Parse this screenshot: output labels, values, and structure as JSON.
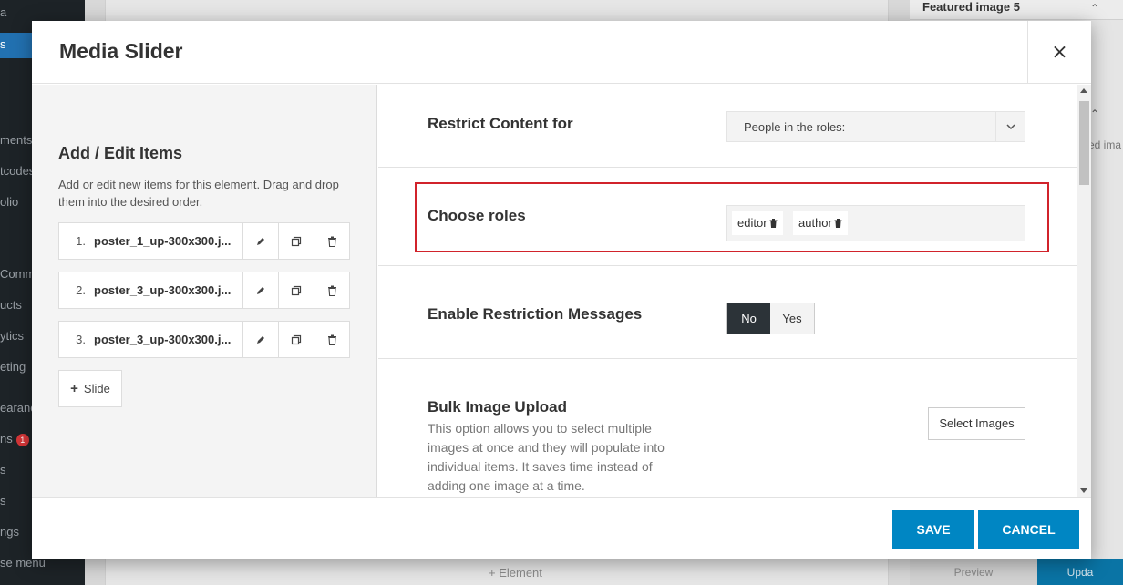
{
  "background": {
    "sidebar_items": [
      "a",
      "s",
      "ments",
      "tcodes",
      "olio",
      "Comm",
      "ucts",
      "ytics",
      "eting",
      "earanc",
      "ns",
      "s",
      "s",
      "ngs",
      "se menu"
    ],
    "badge_count": "1",
    "right_panel_title": "Featured image 5",
    "right_panel_text": "ed ima",
    "add_element_label": "+ Element",
    "preview_label": "Preview",
    "update_label": "Upda"
  },
  "modal": {
    "title": "Media Slider",
    "close_symbol": "×"
  },
  "left": {
    "heading": "Add / Edit Items",
    "description": "Add or edit new items for this element. Drag and drop them into the desired order.",
    "items": [
      {
        "num": "1.",
        "name": "poster_1_up-300x300.j..."
      },
      {
        "num": "2.",
        "name": "poster_3_up-300x300.j..."
      },
      {
        "num": "3.",
        "name": "poster_3_up-300x300.j..."
      }
    ],
    "add_slide_label": "Slide"
  },
  "options": {
    "restrict_label": "Restrict Content for",
    "restrict_value": "People in the roles:",
    "roles_label": "Choose roles",
    "roles": [
      "editor",
      "author"
    ],
    "messages_label": "Enable Restriction Messages",
    "toggle_no": "No",
    "toggle_yes": "Yes",
    "toggle_selected": "No",
    "bulk_label": "Bulk Image Upload",
    "bulk_description": "This option allows you to select multiple images at once and they will populate into individual items. It saves time instead of adding one image at a time.",
    "select_images_label": "Select Images"
  },
  "footer": {
    "save_label": "SAVE",
    "cancel_label": "CANCEL"
  },
  "colors": {
    "primary": "#0086c3",
    "highlight_border": "#d1232b",
    "toggle_active": "#2c3338"
  }
}
